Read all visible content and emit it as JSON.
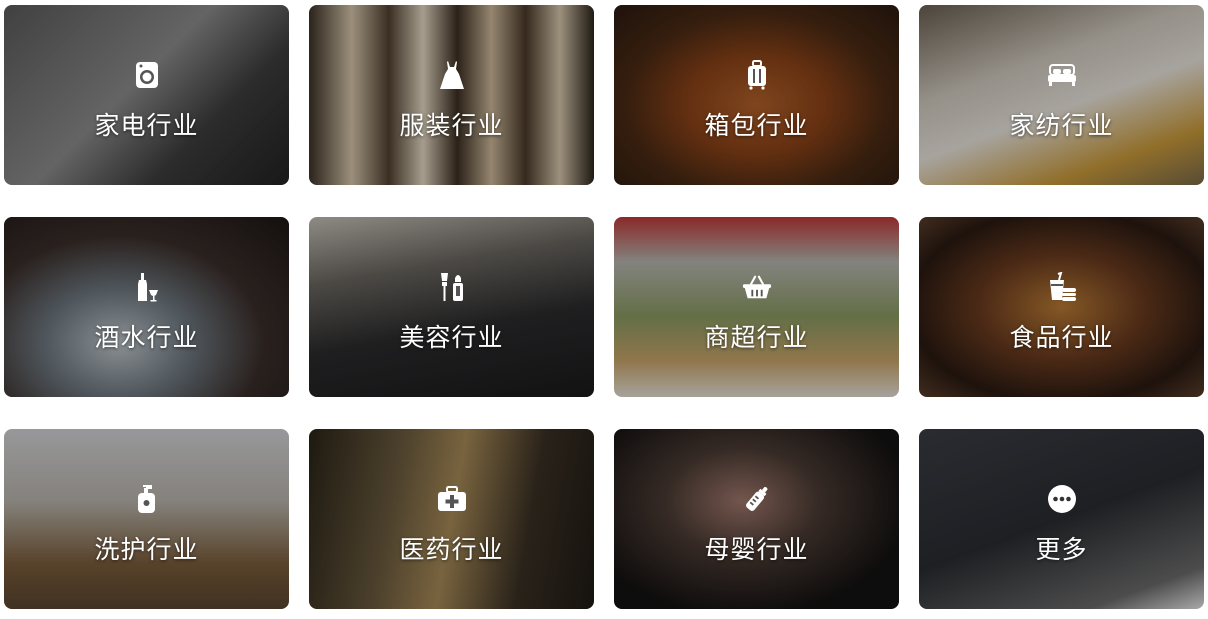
{
  "categories": [
    {
      "label": "家电行业",
      "icon": "washing-machine-icon"
    },
    {
      "label": "服装行业",
      "icon": "dress-icon"
    },
    {
      "label": "箱包行业",
      "icon": "suitcase-icon"
    },
    {
      "label": "家纺行业",
      "icon": "bed-icon"
    },
    {
      "label": "酒水行业",
      "icon": "wine-bottle-icon"
    },
    {
      "label": "美容行业",
      "icon": "cosmetics-icon"
    },
    {
      "label": "商超行业",
      "icon": "shopping-basket-icon"
    },
    {
      "label": "食品行业",
      "icon": "food-drink-icon"
    },
    {
      "label": "洗护行业",
      "icon": "lotion-bottle-icon"
    },
    {
      "label": "医药行业",
      "icon": "medical-kit-icon"
    },
    {
      "label": "母婴行业",
      "icon": "baby-bottle-icon"
    },
    {
      "label": "更多",
      "icon": "more-dots-icon"
    }
  ],
  "colors": {
    "label_text": "#ffffff"
  }
}
